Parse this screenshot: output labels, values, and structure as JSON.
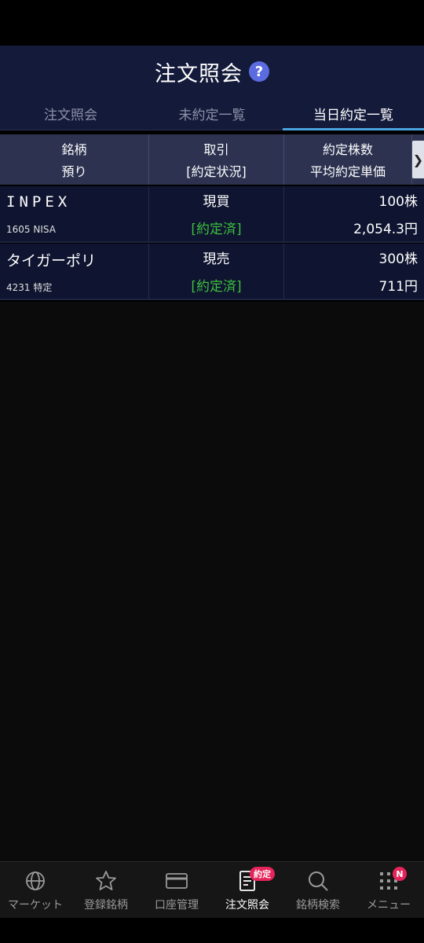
{
  "header": {
    "title": "注文照会",
    "help_icon": "question-circle-icon"
  },
  "tabs": [
    {
      "label": "注文照会",
      "active": false
    },
    {
      "label": "未約定一覧",
      "active": false
    },
    {
      "label": "当日約定一覧",
      "active": true
    }
  ],
  "table_header": {
    "col1": {
      "top": "銘柄",
      "bottom": "預り"
    },
    "col2": {
      "top": "取引",
      "bottom": "[約定状況]"
    },
    "col3": {
      "top": "約定株数",
      "bottom": "平均約定単価"
    },
    "scroll_glyph": "❯"
  },
  "rows": [
    {
      "name": "INPEX",
      "code_account": "1605 NISA",
      "trade": "現買",
      "status": "[約定済]",
      "qty": "100株",
      "price": "2,054.3円"
    },
    {
      "name": "タイガーポリ",
      "code_account": "4231 特定",
      "trade": "現売",
      "status": "[約定済]",
      "qty": "300株",
      "price": "711円"
    }
  ],
  "bottom_nav": [
    {
      "label": "マーケット",
      "icon": "globe-icon"
    },
    {
      "label": "登録銘柄",
      "icon": "star-icon"
    },
    {
      "label": "口座管理",
      "icon": "card-icon"
    },
    {
      "label": "注文照会",
      "icon": "document-icon",
      "badge": "約定",
      "active": true
    },
    {
      "label": "銘柄検索",
      "icon": "search-icon"
    },
    {
      "label": "メニュー",
      "icon": "grid-menu-icon",
      "badge": "N"
    }
  ],
  "colors": {
    "header_bg": "#141a3a",
    "accent": "#4aa3df",
    "status_green": "#3cbf3c",
    "badge": "#e5245a"
  }
}
